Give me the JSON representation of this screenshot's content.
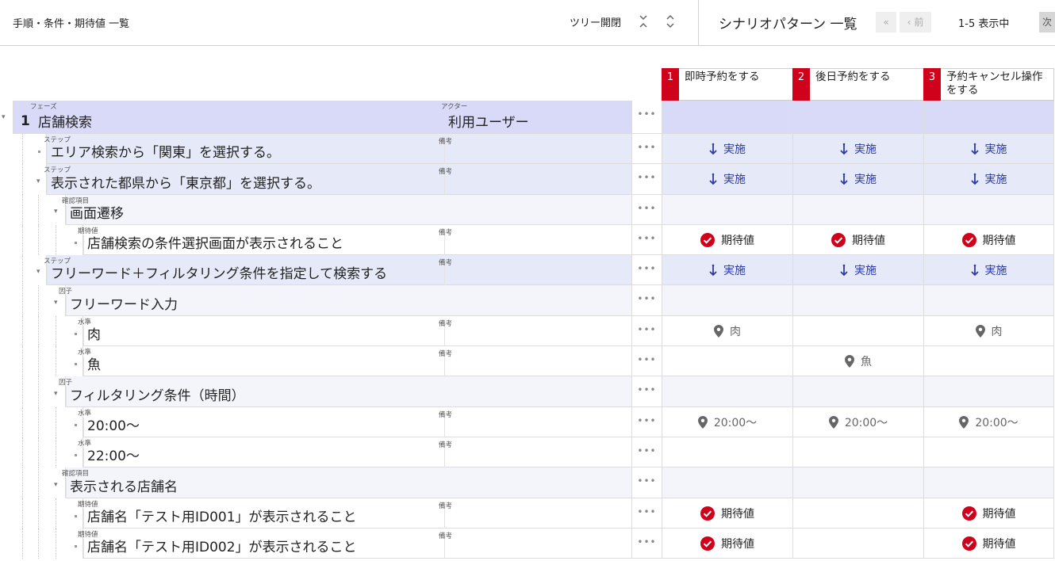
{
  "header": {
    "title": "手順・条件・期待値 一覧",
    "tree_toggle": "ツリー開閉",
    "scenario_title": "シナリオパターン 一覧",
    "prev_label": "前",
    "page_info": "1-5 表示中",
    "next_label": "次"
  },
  "scenarios": [
    {
      "num": "1",
      "label": "即時予約をする"
    },
    {
      "num": "2",
      "label": "後日予約をする"
    },
    {
      "num": "3",
      "label": "予約キャンセル操作をする"
    }
  ],
  "labels": {
    "phase": "フェーズ",
    "actor": "アクター",
    "step": "ステップ",
    "remark": "備考",
    "check": "確認項目",
    "expected": "期待値",
    "factor": "因子",
    "level": "水準",
    "exec": "実施"
  },
  "rows": [
    {
      "kind": "phase",
      "num": "1",
      "text": "店舗検索",
      "actor": "利用ユーザー"
    },
    {
      "kind": "step",
      "text": "エリア検索から「関東」を選択する。"
    },
    {
      "kind": "step",
      "text": "表示された都県から「東京都」を選択する。"
    },
    {
      "kind": "check",
      "text": "画面遷移"
    },
    {
      "kind": "expected",
      "text": "店舗検索の条件選択画面が表示されること"
    },
    {
      "kind": "step",
      "text": "フリーワード＋フィルタリング条件を指定して検索する"
    },
    {
      "kind": "factor",
      "text": "フリーワード入力"
    },
    {
      "kind": "level",
      "text": "肉",
      "cells": [
        "肉",
        "",
        "肉"
      ]
    },
    {
      "kind": "level",
      "text": "魚",
      "cells": [
        "",
        "魚",
        ""
      ]
    },
    {
      "kind": "factor",
      "text": "フィルタリング条件（時間）"
    },
    {
      "kind": "level",
      "text": "20:00～",
      "cells": [
        "20:00～",
        "20:00～",
        "20:00～"
      ]
    },
    {
      "kind": "level",
      "text": "22:00～",
      "cells": [
        "",
        "",
        ""
      ]
    },
    {
      "kind": "check",
      "text": "表示される店舗名"
    },
    {
      "kind": "expected",
      "text": "店舗名「テスト用ID001」が表示されること",
      "cells": [
        true,
        false,
        true
      ]
    },
    {
      "kind": "expected",
      "text": "店舗名「テスト用ID002」が表示されること",
      "cells": [
        true,
        false,
        true
      ]
    }
  ],
  "colors": {
    "accent": "#d0021b",
    "phase_bg": "#d9daf7",
    "step_bg": "#e6e9f8",
    "exec": "#2b3aa8"
  },
  "icons": {
    "exec": "arrow-down-icon",
    "expected": "check-circle-icon",
    "level": "map-pin-icon"
  }
}
